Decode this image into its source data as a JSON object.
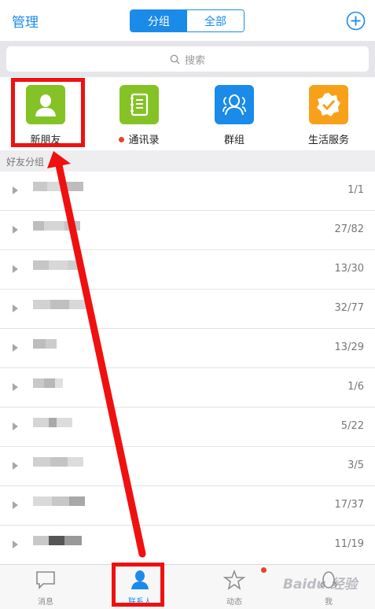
{
  "header": {
    "manage_label": "管理",
    "segment": {
      "left": "分组",
      "right": "全部"
    },
    "add_icon": "plus-circle-icon"
  },
  "search": {
    "placeholder": "搜索"
  },
  "quick_entries": [
    {
      "label": "新朋友",
      "icon": "person-icon",
      "color": "#85c226"
    },
    {
      "label": "通讯录",
      "icon": "address-book-icon",
      "color": "#85c226",
      "has_dot": true
    },
    {
      "label": "群组",
      "icon": "group-icon",
      "color": "#1a8be8"
    },
    {
      "label": "生活服务",
      "icon": "badge-check-icon",
      "color": "#f7a11a"
    }
  ],
  "section": {
    "title": "好友分组"
  },
  "groups": [
    {
      "count": "1/1"
    },
    {
      "count": "27/82"
    },
    {
      "count": "13/30"
    },
    {
      "count": "32/77"
    },
    {
      "count": "13/29"
    },
    {
      "count": "1/6"
    },
    {
      "count": "5/22"
    },
    {
      "count": "3/5"
    },
    {
      "count": "17/37"
    },
    {
      "count": "11/19"
    }
  ],
  "tabbar": [
    {
      "label": "消息",
      "icon": "message-icon"
    },
    {
      "label": "联系人",
      "icon": "contacts-icon",
      "active": true
    },
    {
      "label": "动态",
      "icon": "star-icon",
      "has_dot": true
    },
    {
      "label": "我",
      "icon": "penguin-icon"
    }
  ],
  "watermark": "Baidu 经验",
  "colors": {
    "accent": "#1a8be8",
    "annotation": "#f01010"
  }
}
